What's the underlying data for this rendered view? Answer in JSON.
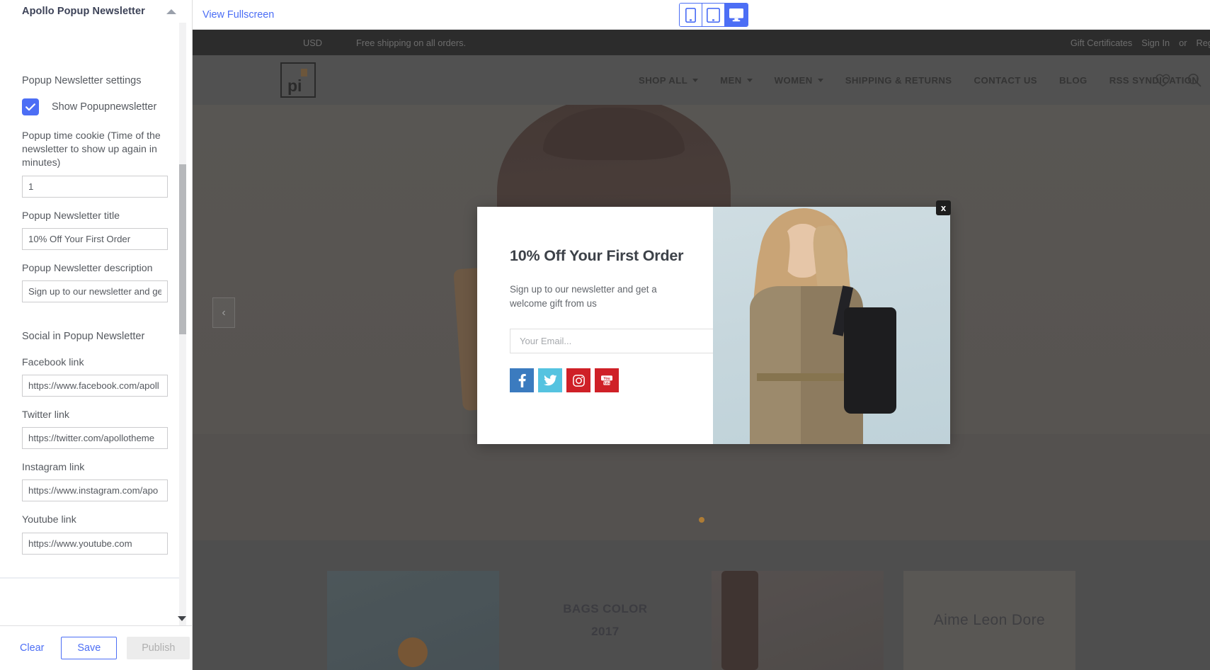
{
  "sidebar": {
    "panel_title": "Apollo Popup Newsletter",
    "collapse_icon": "chevron-up-icon",
    "section_settings_title": "Popup Newsletter settings",
    "show_popup_label": "Show Popupnewsletter",
    "show_popup_checked": true,
    "fields": [
      {
        "label": "Popup time cookie (Time of the newsletter to show up again in minutes)",
        "value": "1",
        "name": "popup-time-cookie"
      },
      {
        "label": "Popup Newsletter title",
        "value": "10% Off Your First Order",
        "name": "popup-newsletter-title"
      },
      {
        "label": "Popup Newsletter description",
        "value": "Sign up to our newsletter and get",
        "name": "popup-newsletter-description"
      }
    ],
    "section_social_title": "Social in Popup Newsletter",
    "social_fields": [
      {
        "label": "Facebook link",
        "value": "https://www.facebook.com/apoll",
        "name": "facebook-link"
      },
      {
        "label": "Twitter link",
        "value": "https://twitter.com/apollotheme",
        "name": "twitter-link"
      },
      {
        "label": "Instagram link",
        "value": "https://www.instagram.com/apo",
        "name": "instagram-link"
      },
      {
        "label": "Youtube link",
        "value": "https://www.youtube.com",
        "name": "youtube-link"
      }
    ],
    "footer": {
      "clear_label": "Clear",
      "save_label": "Save",
      "publish_label": "Publish"
    },
    "accent_color": "#4c6ef5"
  },
  "toolbar": {
    "fullscreen_label": "View Fullscreen",
    "devices": [
      {
        "name": "mobile",
        "icon": "mobile-icon",
        "active": false
      },
      {
        "name": "tablet",
        "icon": "tablet-icon",
        "active": false
      },
      {
        "name": "desktop",
        "icon": "desktop-icon",
        "active": true
      }
    ]
  },
  "site": {
    "topbar": {
      "currency": "USD",
      "promo": "Free shipping on all orders.",
      "gift_certificates": "Gift Certificates",
      "sign_in": "Sign In",
      "or": "or",
      "register": "Reg"
    },
    "logo_text": "pi",
    "nav": [
      {
        "label": "SHOP ALL",
        "has_caret": true
      },
      {
        "label": "MEN",
        "has_caret": true
      },
      {
        "label": "WOMEN",
        "has_caret": true
      },
      {
        "label": "SHIPPING & RETURNS",
        "has_caret": false
      },
      {
        "label": "CONTACT US",
        "has_caret": false
      },
      {
        "label": "BLOG",
        "has_caret": false
      },
      {
        "label": "RSS SYNDICATION",
        "has_caret": false
      }
    ],
    "header_icons": [
      {
        "name": "wishlist-heart-icon"
      },
      {
        "name": "search-icon"
      }
    ],
    "hero": {
      "prev_arrow": "‹",
      "dot_color": "#e8a13c"
    },
    "promos": [
      {
        "title": "",
        "style": "image"
      },
      {
        "title": "BAGS COLOR\n2017",
        "style": "text"
      },
      {
        "title": "",
        "style": "image"
      },
      {
        "title": "Aime Leon Dore",
        "style": "text-light"
      }
    ],
    "promo_text_1": "BAGS COLOR",
    "promo_text_1b": "2017",
    "promo_text_2": "Aime Leon Dore"
  },
  "popup": {
    "title": "10% Off Your First Order",
    "description": "Sign up to our newsletter and get a welcome gift from us",
    "email_placeholder": "Your Email...",
    "email_value": "",
    "submit_icon": "envelope-icon",
    "submit_color": "#f5b731",
    "close_label": "x",
    "socials": [
      {
        "name": "facebook-icon",
        "color": "#3b7bbf"
      },
      {
        "name": "twitter-icon",
        "color": "#55c3e0"
      },
      {
        "name": "instagram-icon",
        "color": "#cf2027"
      },
      {
        "name": "youtube-icon",
        "color": "#cf2027"
      }
    ]
  }
}
